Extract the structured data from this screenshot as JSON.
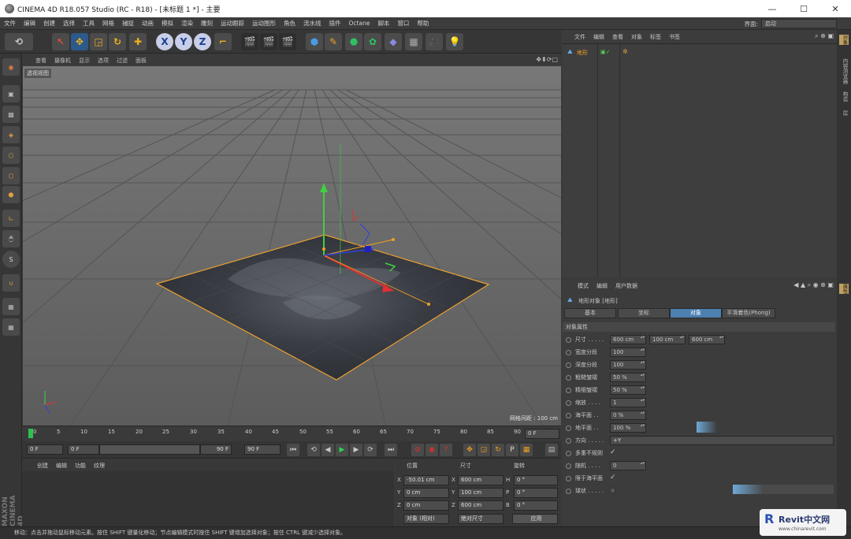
{
  "window": {
    "title": "CINEMA 4D R18.057 Studio (RC - R18) - [未标题 1 *] - 主要"
  },
  "menu": [
    "文件",
    "编辑",
    "创建",
    "选择",
    "工具",
    "网格",
    "捕捉",
    "动画",
    "模拟",
    "渲染",
    "雕刻",
    "运动跟踪",
    "运动图形",
    "角色",
    "流水线",
    "插件",
    "Octane",
    "脚本",
    "窗口",
    "帮助"
  ],
  "layout": {
    "label": "界面:",
    "value": "启动"
  },
  "toolbar": {
    "x": "X",
    "y": "Y",
    "z": "Z"
  },
  "viewport": {
    "menu": [
      "查看",
      "摄像机",
      "显示",
      "选项",
      "过滤",
      "面板"
    ],
    "label": "透视视图",
    "grid_spacing": "网格间距 : 100 cm"
  },
  "timeline": {
    "ticks": [
      "0",
      "5",
      "10",
      "15",
      "20",
      "25",
      "30",
      "35",
      "40",
      "45",
      "50",
      "55",
      "60",
      "65",
      "70",
      "75",
      "80",
      "85",
      "90"
    ],
    "current": "0 F",
    "start": "0 F",
    "slider_start": "0 F",
    "slider_end": "90 F",
    "end": "90 F"
  },
  "material": {
    "menu": [
      "创建",
      "编辑",
      "功能",
      "纹理"
    ]
  },
  "coords": {
    "headers": [
      "位置",
      "尺寸",
      "旋转"
    ],
    "rows": [
      {
        "axis": "X",
        "pos": "-50.01 cm",
        "size_axis": "X",
        "size": "600 cm",
        "rot_axis": "H",
        "rot": "0 °"
      },
      {
        "axis": "Y",
        "pos": "0 cm",
        "size_axis": "Y",
        "size": "100 cm",
        "rot_axis": "P",
        "rot": "0 °"
      },
      {
        "axis": "Z",
        "pos": "0 cm",
        "size_axis": "Z",
        "size": "600 cm",
        "rot_axis": "B",
        "rot": "0 °"
      }
    ],
    "mode": "对象 (相对)",
    "size_mode": "绝对尺寸",
    "apply": "应用"
  },
  "object_manager": {
    "menu": [
      "文件",
      "编辑",
      "查看",
      "对象",
      "标签",
      "书签"
    ],
    "object": "地形"
  },
  "right_tabs": [
    "对象",
    "内容浏览器",
    "构造",
    "层"
  ],
  "attribute_manager": {
    "menu": [
      "模式",
      "编辑",
      "用户数据"
    ],
    "title": "地形对象 [地形]",
    "tabs": [
      "基本",
      "坐标",
      "对象",
      "平滑着色(Phong)"
    ],
    "section": "对象属性",
    "props": [
      {
        "label": "尺寸 . . . . .",
        "values": [
          "600 cm",
          "100 cm",
          "600 cm"
        ]
      },
      {
        "label": "宽度分段",
        "values": [
          "100"
        ]
      },
      {
        "label": "深度分段",
        "values": [
          "100"
        ]
      },
      {
        "label": "粗糙皱褶",
        "values": [
          "50 %"
        ]
      },
      {
        "label": "精细皱褶",
        "values": [
          "50 %"
        ]
      },
      {
        "label": "缩放 . . . .",
        "values": [
          "1"
        ]
      },
      {
        "label": "海平面 . .",
        "values": [
          "0 %"
        ]
      },
      {
        "label": "地平面 . .",
        "values": [
          "100 %"
        ]
      },
      {
        "label": "方向 . . . . .",
        "values": [
          "+Y"
        ]
      },
      {
        "label": "多重不规则",
        "values": [
          "✓"
        ]
      },
      {
        "label": "随机 . . . .",
        "values": [
          "0"
        ]
      },
      {
        "label": "限于海平面",
        "values": [
          "✓"
        ]
      },
      {
        "label": "球状 . . . . .",
        "values": [
          ""
        ]
      }
    ],
    "attr_tab": "属性"
  },
  "status": "移动：点击并拖动鼠标移动元素。按住 SHIFT 键量化移动；节点编辑模式时按住 SHIFT 键增加选择对象；按住 CTRL 键减少选择对象。",
  "watermark": {
    "brand": "Revit中文网",
    "url": "www.chinarevit.com"
  },
  "maxon": "MAXON CINEMA 4D"
}
